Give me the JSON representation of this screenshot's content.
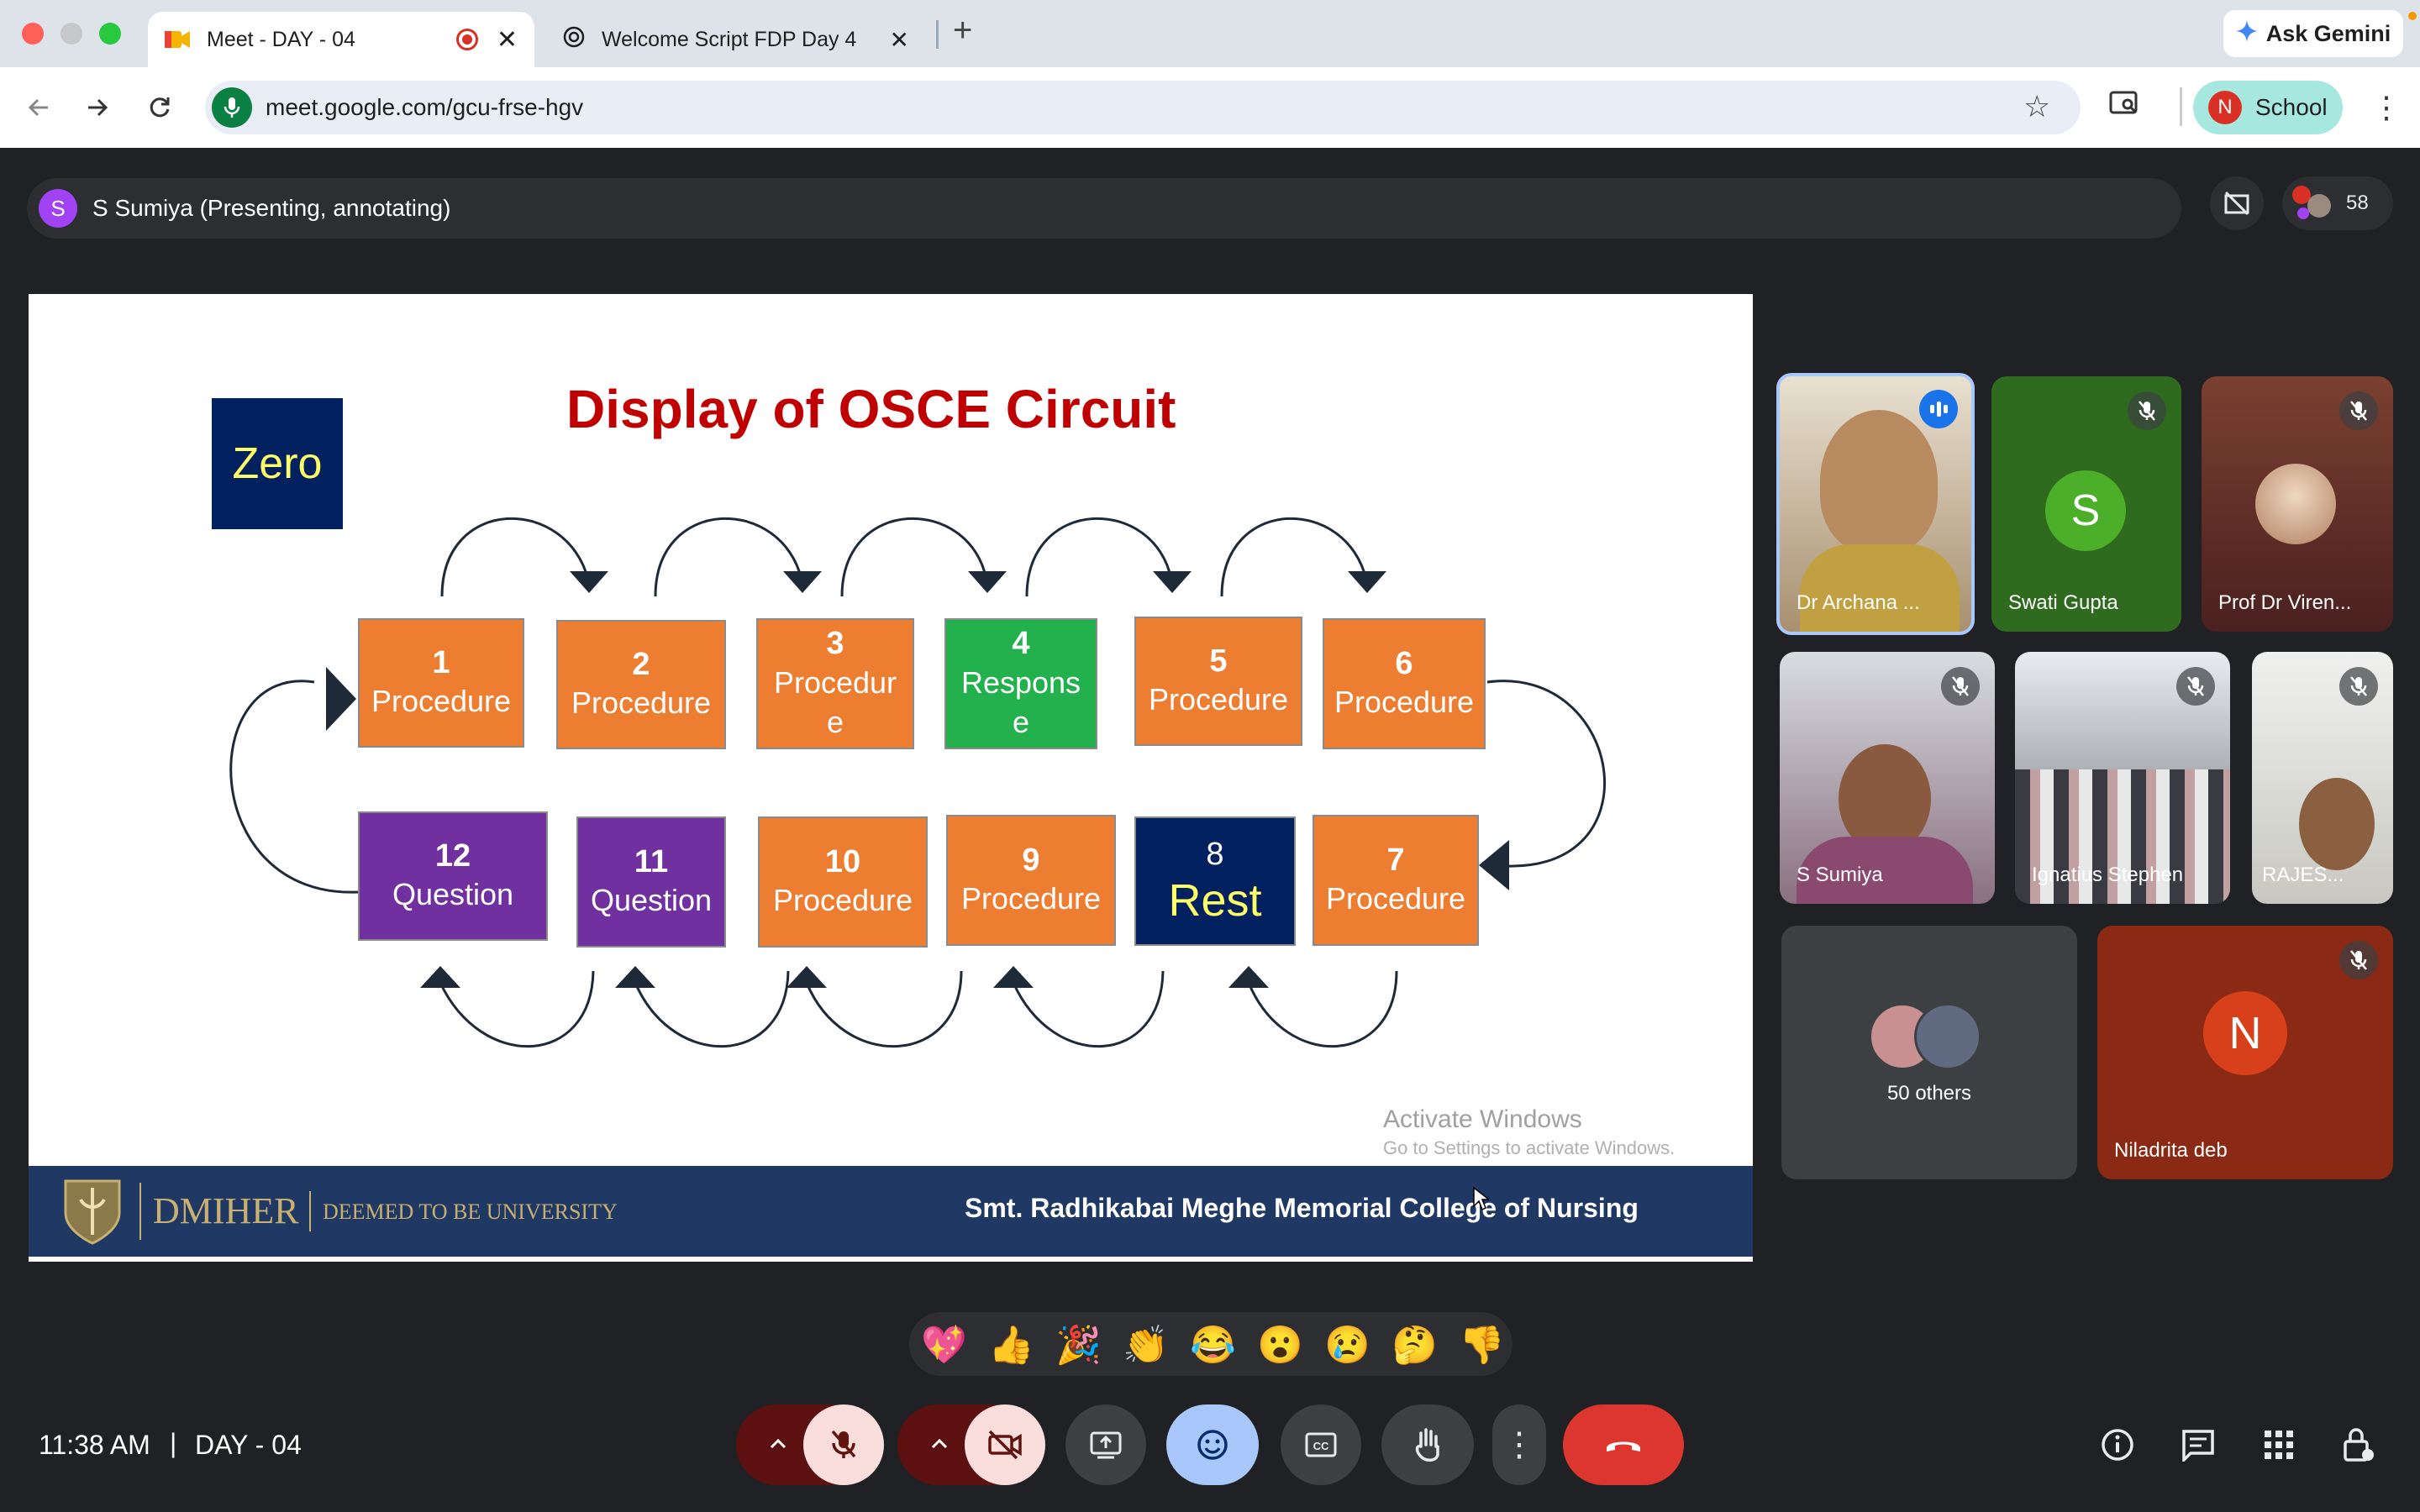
{
  "browser": {
    "tabs": [
      {
        "title": "Meet - DAY - 04",
        "active": true,
        "recording": true
      },
      {
        "title": "Welcome Script FDP Day 4",
        "active": false
      }
    ],
    "gemini_label": "Ask Gemini",
    "url": "meet.google.com/gcu-frse-hgv",
    "profile_initial": "N",
    "profile_label": "School"
  },
  "meet": {
    "presenter_initial": "S",
    "presenter_label": "S Sumiya (Presenting, annotating)",
    "participant_count": "58",
    "time": "11:38 AM",
    "separator": "|",
    "meeting_name": "DAY - 04",
    "participants": [
      {
        "name": "Dr Archana ...",
        "speaking": true
      },
      {
        "name": "Swati Gupta",
        "initial": "S",
        "muted": true,
        "color": "#4caf2a"
      },
      {
        "name": "Prof Dr Viren...",
        "muted": true
      },
      {
        "name": "S Sumiya",
        "muted": true
      },
      {
        "name": "Ignatius Stephen",
        "muted": true
      },
      {
        "name": "RAJES...",
        "muted": true
      },
      {
        "name": "50 others"
      },
      {
        "name": "Niladrita deb",
        "initial": "N",
        "muted": true,
        "color": "#c8401e"
      }
    ],
    "reactions": [
      "💖",
      "👍",
      "🎉",
      "👏",
      "😂",
      "😮",
      "😢",
      "🤔",
      "👎"
    ]
  },
  "slide": {
    "title": "Display of OSCE Circuit",
    "zero_label": "Zero",
    "boxes": [
      {
        "num": "1",
        "label": "Procedure",
        "color": "#ed7d31"
      },
      {
        "num": "2",
        "label": "Procedure",
        "color": "#ed7d31"
      },
      {
        "num": "3",
        "label1": "Procedur",
        "label2": "e",
        "color": "#ed7d31"
      },
      {
        "num": "4",
        "label1": "Respons",
        "label2": "e",
        "color": "#22b14c"
      },
      {
        "num": "5",
        "label": "Procedure",
        "color": "#ed7d31"
      },
      {
        "num": "6",
        "label": "Procedure",
        "color": "#ed7d31"
      },
      {
        "num": "7",
        "label": "Procedure",
        "color": "#ed7d31"
      },
      {
        "num": "8",
        "label": "Rest",
        "color": "#002060"
      },
      {
        "num": "9",
        "label": "Procedure",
        "color": "#ed7d31"
      },
      {
        "num": "10",
        "label": "Procedure",
        "color": "#ed7d31"
      },
      {
        "num": "11",
        "label": "Question",
        "color": "#7030a0"
      },
      {
        "num": "12",
        "label": "Question",
        "color": "#7030a0"
      }
    ],
    "watermark_title": "Activate Windows",
    "watermark_sub": "Go to Settings to activate Windows.",
    "footer_org": "DMIHER",
    "footer_tag": "DEEMED TO BE UNIVERSITY",
    "footer_college": "Smt. Radhikabai Meghe Memorial College of Nursing"
  }
}
